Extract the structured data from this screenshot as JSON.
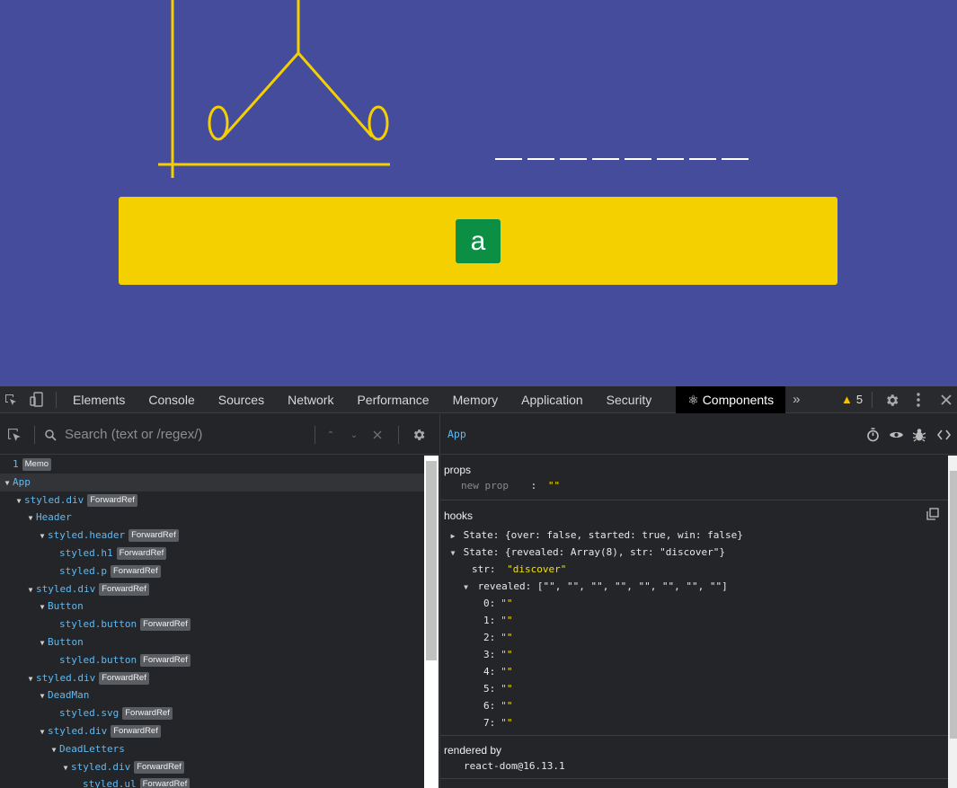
{
  "game": {
    "keyboard": {
      "letters": [
        "a"
      ]
    },
    "word_blanks": 8,
    "colors": {
      "background": "#454c9c",
      "gallows": "#f5d000",
      "keyboard": "#f5d000",
      "letter_button": "#0b8f45"
    }
  },
  "devtools": {
    "tabs": [
      "Elements",
      "Console",
      "Sources",
      "Network",
      "Performance",
      "Memory",
      "Application",
      "Security",
      "⚛ Components"
    ],
    "active_tab": "⚛ Components",
    "more_tabs": "»",
    "warnings_count": "5",
    "search": {
      "placeholder": "Search (text or /regex/)",
      "value": ""
    },
    "tree": [
      {
        "depth": 0,
        "arrow": "",
        "prefix": "1",
        "name": "",
        "badge": "Memo"
      },
      {
        "depth": 0,
        "arrow": "▼",
        "name": "App",
        "badge": "",
        "selected": true
      },
      {
        "depth": 1,
        "arrow": "▼",
        "name": "styled.div",
        "badge": "ForwardRef"
      },
      {
        "depth": 2,
        "arrow": "▼",
        "name": "Header",
        "badge": ""
      },
      {
        "depth": 3,
        "arrow": "▼",
        "name": "styled.header",
        "badge": "ForwardRef"
      },
      {
        "depth": 4,
        "arrow": "",
        "name": "styled.h1",
        "badge": "ForwardRef"
      },
      {
        "depth": 4,
        "arrow": "",
        "name": "styled.p",
        "badge": "ForwardRef"
      },
      {
        "depth": 2,
        "arrow": "▼",
        "name": "styled.div",
        "badge": "ForwardRef"
      },
      {
        "depth": 3,
        "arrow": "▼",
        "name": "Button",
        "badge": ""
      },
      {
        "depth": 4,
        "arrow": "",
        "name": "styled.button",
        "badge": "ForwardRef"
      },
      {
        "depth": 3,
        "arrow": "▼",
        "name": "Button",
        "badge": ""
      },
      {
        "depth": 4,
        "arrow": "",
        "name": "styled.button",
        "badge": "ForwardRef"
      },
      {
        "depth": 2,
        "arrow": "▼",
        "name": "styled.div",
        "badge": "ForwardRef"
      },
      {
        "depth": 3,
        "arrow": "▼",
        "name": "DeadMan",
        "badge": ""
      },
      {
        "depth": 4,
        "arrow": "",
        "name": "styled.svg",
        "badge": "ForwardRef"
      },
      {
        "depth": 3,
        "arrow": "▼",
        "name": "styled.div",
        "badge": "ForwardRef"
      },
      {
        "depth": 4,
        "arrow": "▼",
        "name": "DeadLetters",
        "badge": ""
      },
      {
        "depth": 5,
        "arrow": "▼",
        "name": "styled.div",
        "badge": "ForwardRef"
      },
      {
        "depth": 6,
        "arrow": "",
        "name": "styled.ul",
        "badge": "ForwardRef"
      }
    ],
    "inspector": {
      "selected_component": "App",
      "props_title": "props",
      "new_prop_placeholder": "new prop",
      "new_prop_sep": ":",
      "new_prop_value": "\"\"",
      "hooks_title": "hooks",
      "state1_label": "State:",
      "state1_value": "{over: false, started: true, win: false}",
      "state2_label": "State:",
      "state2_value": "{revealed: Array(8), str: \"discover\"}",
      "str_key": "str:",
      "str_value": "\"discover\"",
      "revealed_key": "revealed:",
      "revealed_value": "[\"\", \"\", \"\", \"\", \"\", \"\", \"\", \"\"]",
      "revealed_items": [
        {
          "key": "0:",
          "value": "\"\""
        },
        {
          "key": "1:",
          "value": "\"\""
        },
        {
          "key": "2:",
          "value": "\"\""
        },
        {
          "key": "3:",
          "value": "\"\""
        },
        {
          "key": "4:",
          "value": "\"\""
        },
        {
          "key": "5:",
          "value": "\"\""
        },
        {
          "key": "6:",
          "value": "\"\""
        },
        {
          "key": "7:",
          "value": "\"\""
        }
      ],
      "rendered_by_title": "rendered by",
      "rendered_by_value": "react-dom@16.13.1"
    }
  }
}
